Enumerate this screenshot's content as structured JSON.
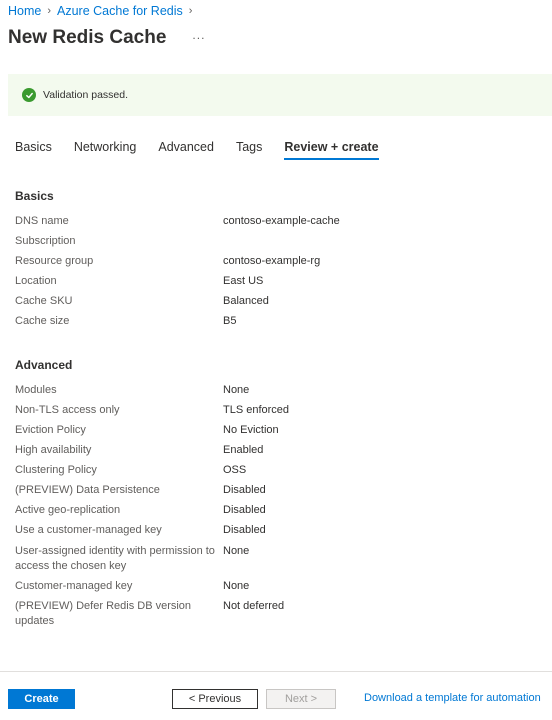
{
  "breadcrumb": [
    {
      "label": "Home"
    },
    {
      "label": "Azure Cache for Redis"
    }
  ],
  "page": {
    "title": "New Redis Cache",
    "more_label": "..."
  },
  "banner": {
    "icon": "check-circle-icon",
    "message": "Validation passed.",
    "color": "#3a9a2f"
  },
  "tabs": [
    {
      "label": "Basics"
    },
    {
      "label": "Networking"
    },
    {
      "label": "Advanced"
    },
    {
      "label": "Tags"
    },
    {
      "label": "Review + create",
      "active": true
    }
  ],
  "basics": {
    "title": "Basics",
    "rows": [
      {
        "label": "DNS name",
        "value": "contoso-example-cache"
      },
      {
        "label": "Subscription",
        "value": ""
      },
      {
        "label": "Resource group",
        "value": "contoso-example-rg"
      },
      {
        "label": "Location",
        "value": "East US"
      },
      {
        "label": "Cache SKU",
        "value": "Balanced"
      },
      {
        "label": "Cache size",
        "value": "B5"
      }
    ]
  },
  "advanced": {
    "title": "Advanced",
    "rows": [
      {
        "label": "Modules",
        "value": "None"
      },
      {
        "label": "Non-TLS access only",
        "value": "TLS enforced"
      },
      {
        "label": "Eviction Policy",
        "value": "No Eviction"
      },
      {
        "label": "High availability",
        "value": "Enabled"
      },
      {
        "label": "Clustering Policy",
        "value": "OSS"
      },
      {
        "label": "(PREVIEW) Data Persistence",
        "value": "Disabled"
      },
      {
        "label": "Active geo-replication",
        "value": "Disabled"
      },
      {
        "label": "Use a customer-managed key",
        "value": "Disabled"
      },
      {
        "label": "User-assigned identity with permission to access the chosen key",
        "value": "None"
      },
      {
        "label": "Customer-managed key",
        "value": "None"
      },
      {
        "label": "(PREVIEW) Defer Redis DB version updates",
        "value": "Not deferred"
      }
    ]
  },
  "footer": {
    "create_label": "Create",
    "previous_label": "< Previous",
    "next_label": "Next >",
    "download_label": "Download a template for automation",
    "accent_color": "#0078d4"
  }
}
